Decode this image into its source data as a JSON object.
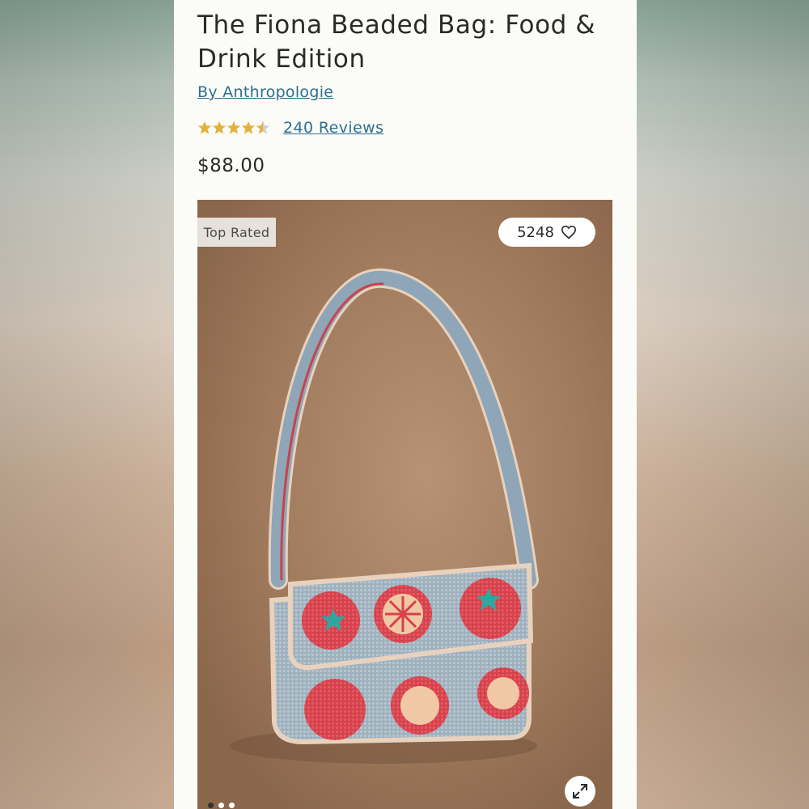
{
  "product": {
    "title": "The Fiona Beaded Bag: Food & Drink Edition",
    "brand": "By Anthropologie",
    "rating": 4.5,
    "reviews_label": "240 Reviews",
    "price": "$88.00"
  },
  "gallery": {
    "badge": "Top Rated",
    "likes": "5248",
    "image_subject": "beaded shoulder bag with tomato pattern",
    "dots": [
      true,
      false,
      false
    ]
  },
  "colors": {
    "link": "#2f6f8f",
    "star": "#e3b23c",
    "text": "#2a2a2a"
  },
  "icons": {
    "like": "heart-icon",
    "expand": "expand-icon"
  }
}
